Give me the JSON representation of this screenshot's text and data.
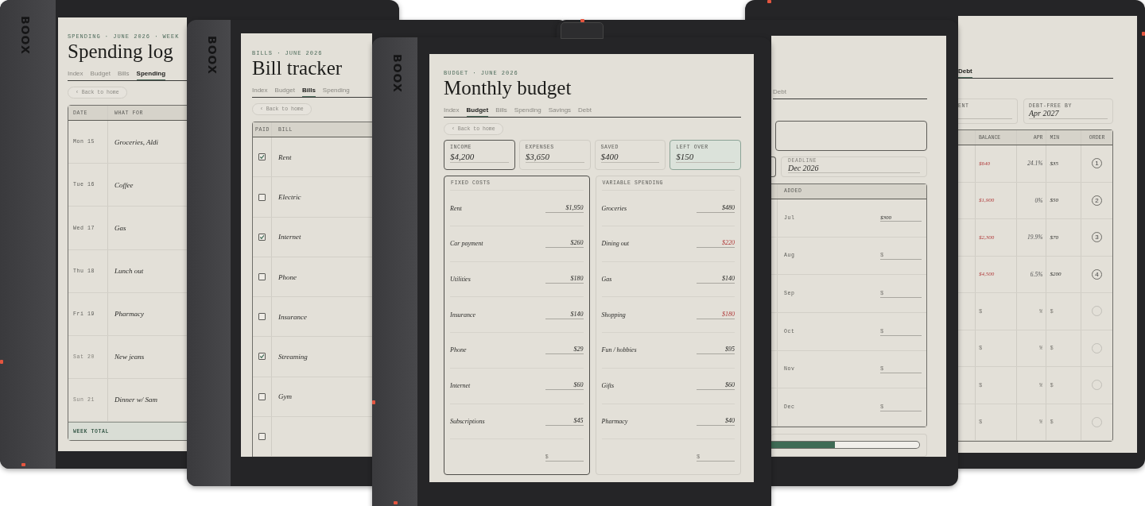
{
  "spending_log": {
    "brand": "BOOX",
    "eyebrow": "SPENDING · JUNE 2026 · WEEK",
    "title": "Spending log",
    "tabs": [
      {
        "label": "Index",
        "selected": false
      },
      {
        "label": "Budget",
        "selected": false
      },
      {
        "label": "Bills",
        "selected": false
      },
      {
        "label": "Spending",
        "selected": true
      }
    ],
    "back_button": "‹ Back to home",
    "columns": [
      "DATE",
      "WHAT FOR"
    ],
    "rows": [
      {
        "date": "Mon 15",
        "item": "Groceries, Aldi",
        "muted": false
      },
      {
        "date": "Tue 16",
        "item": "Coffee",
        "muted": false
      },
      {
        "date": "Wed 17",
        "item": "Gas",
        "muted": false
      },
      {
        "date": "Thu 18",
        "item": "Lunch out",
        "muted": false
      },
      {
        "date": "Fri 19",
        "item": "Pharmacy",
        "muted": false
      },
      {
        "date": "Sat 20",
        "item": "New jeans",
        "muted": true
      },
      {
        "date": "Sun 21",
        "item": "Dinner w/ Sam",
        "muted": true
      }
    ],
    "footer": "WEEK TOTAL"
  },
  "bill_tracker": {
    "brand": "BOOX",
    "eyebrow": "BILLS · JUNE 2026",
    "title": "Bill tracker",
    "tabs": [
      {
        "label": "Index",
        "selected": false
      },
      {
        "label": "Budget",
        "selected": false
      },
      {
        "label": "Bills",
        "selected": true
      },
      {
        "label": "Spending",
        "selected": false
      }
    ],
    "back_button": "‹ Back to home",
    "columns": [
      "PAID",
      "BILL"
    ],
    "rows": [
      {
        "name": "Rent",
        "checked": true
      },
      {
        "name": "Electric",
        "checked": false
      },
      {
        "name": "Internet",
        "checked": true
      },
      {
        "name": "Phone",
        "checked": false
      },
      {
        "name": "Insurance",
        "checked": false
      },
      {
        "name": "Streaming",
        "checked": true
      },
      {
        "name": "Gym",
        "checked": false
      },
      {
        "checked": false
      }
    ]
  },
  "monthly_budget": {
    "brand": "BOOX",
    "eyebrow": "BUDGET · JUNE 2026",
    "title": "Monthly budget",
    "tabs": [
      {
        "label": "Index",
        "selected": false
      },
      {
        "label": "Budget",
        "selected": true
      },
      {
        "label": "Bills",
        "selected": false
      },
      {
        "label": "Spending",
        "selected": false
      },
      {
        "label": "Savings",
        "selected": false
      },
      {
        "label": "Debt",
        "selected": false
      }
    ],
    "back_button": "‹ Back to home",
    "stats": [
      {
        "label": "INCOME",
        "value": "$4,200",
        "kind": "outlined"
      },
      {
        "label": "EXPENSES",
        "value": "$3,650",
        "kind": "plain"
      },
      {
        "label": "SAVED",
        "value": "$400",
        "kind": "plain"
      },
      {
        "label": "LEFT OVER",
        "value": "$150",
        "kind": "accent"
      }
    ],
    "panels": [
      {
        "title": "FIXED COSTS",
        "focused": true,
        "rows": [
          {
            "label": "Rent",
            "amount": "$1,950",
            "over": false
          },
          {
            "label": "Car payment",
            "amount": "$260",
            "over": false
          },
          {
            "label": "Utilities",
            "amount": "$180",
            "over": false
          },
          {
            "label": "Insurance",
            "amount": "$140",
            "over": false
          },
          {
            "label": "Phone",
            "amount": "$29",
            "over": false
          },
          {
            "label": "Internet",
            "amount": "$60",
            "over": false
          },
          {
            "label": "Subscriptions",
            "amount": "$45",
            "over": false
          },
          {
            "placeholder": "$"
          }
        ]
      },
      {
        "title": "VARIABLE SPENDING",
        "focused": false,
        "rows": [
          {
            "label": "Groceries",
            "amount": "$480",
            "over": false
          },
          {
            "label": "Dining out",
            "amount": "$220",
            "over": true
          },
          {
            "label": "Gas",
            "amount": "$140",
            "over": false
          },
          {
            "label": "Shopping",
            "amount": "$180",
            "over": true
          },
          {
            "label": "Fun / hobbies",
            "amount": "$95",
            "over": false
          },
          {
            "label": "Gifts",
            "amount": "$60",
            "over": false
          },
          {
            "label": "Pharmacy",
            "amount": "$40",
            "over": false
          },
          {
            "placeholder": "$"
          }
        ]
      }
    ]
  },
  "savings_page": {
    "tabs": [
      {
        "label": "Debt",
        "selected": false
      }
    ],
    "deadline": {
      "label": "DEADLINE",
      "value": "Dec 2026"
    },
    "column": "ADDED",
    "rows": [
      {
        "month": "Jul",
        "amount": "$300"
      },
      {
        "month": "Aug",
        "placeholder": "$"
      },
      {
        "month": "Sep",
        "placeholder": "$"
      },
      {
        "month": "Oct",
        "placeholder": "$"
      },
      {
        "month": "Nov",
        "placeholder": "$"
      },
      {
        "month": "Dec",
        "placeholder": "$"
      }
    ],
    "progress": {
      "level": 0.43
    }
  },
  "debt_page": {
    "tabs": [
      {
        "label": "Debt",
        "selected": true
      }
    ],
    "stats": [
      {
        "label": "ENT"
      },
      {
        "label": "DEBT-FREE BY",
        "value": "Apr 2027"
      }
    ],
    "columns": [
      "BALANCE",
      "APR",
      "MIN",
      "ORDER"
    ],
    "rows": [
      {
        "balance": "$640",
        "apr": "24.1%",
        "min": "$35",
        "order": "1"
      },
      {
        "balance": "$1,900",
        "apr": "0%",
        "min": "$50",
        "order": "2"
      },
      {
        "balance": "$2,300",
        "apr": "19.9%",
        "min": "$70",
        "order": "3"
      },
      {
        "balance": "$4,500",
        "apr": "6.5%",
        "min": "$200",
        "order": "4"
      },
      {
        "balance_placeholder": "$",
        "apr_placeholder": "%",
        "min_placeholder": "$"
      },
      {
        "balance_placeholder": "$",
        "apr_placeholder": "%",
        "min_placeholder": "$"
      },
      {
        "balance_placeholder": "$",
        "apr_placeholder": "%",
        "min_placeholder": "$"
      },
      {
        "balance_placeholder": "$",
        "apr_placeholder": "%",
        "min_placeholder": "$"
      }
    ]
  }
}
